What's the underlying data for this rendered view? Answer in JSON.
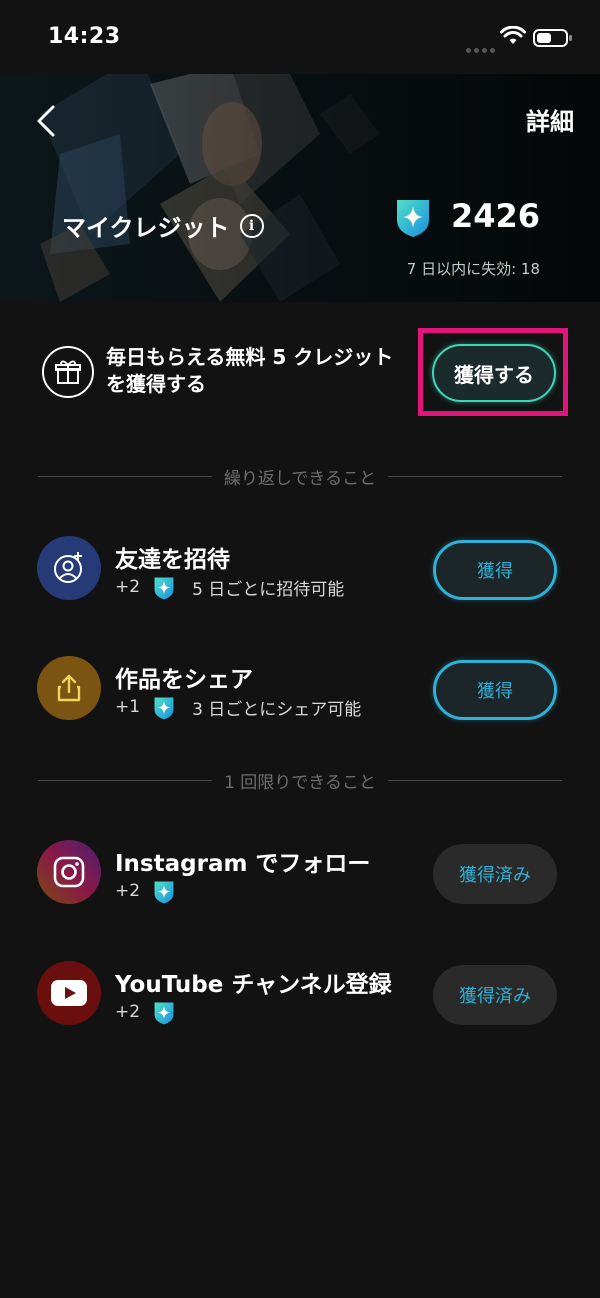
{
  "status_bar": {
    "time": "14:23"
  },
  "header": {
    "detail_label": "詳細",
    "title": "マイクレジット",
    "info_glyph": "i",
    "balance": "2426",
    "expiry": "7 日以内に失効: 18"
  },
  "daily": {
    "text_line1": "毎日もらえる無料 5 クレジット",
    "text_line2": "を獲得する",
    "button_label": "獲得する"
  },
  "sections": {
    "repeatable_label": "繰り返しできること",
    "one_time_label": "1 回限りできること"
  },
  "tasks": [
    {
      "title": "友達を招待",
      "reward": "+2",
      "note": "5 日ごとに招待可能",
      "button": "獲得",
      "icon": "invite-friend-icon",
      "state": "active"
    },
    {
      "title": "作品をシェア",
      "reward": "+1",
      "note": "3 日ごとにシェア可能",
      "button": "獲得",
      "icon": "share-icon",
      "state": "active"
    },
    {
      "title": "Instagram でフォロー",
      "reward": "+2",
      "note": "",
      "button": "獲得済み",
      "icon": "instagram-icon",
      "state": "done"
    },
    {
      "title": "YouTube チャンネル登録",
      "reward": "+2",
      "note": "",
      "button": "獲得済み",
      "icon": "youtube-icon",
      "state": "done"
    }
  ],
  "colors": {
    "accent_cyan": "#2fb0d6",
    "accent_teal": "#3dd6b8",
    "highlight": "#e0147a",
    "background": "#121212"
  }
}
